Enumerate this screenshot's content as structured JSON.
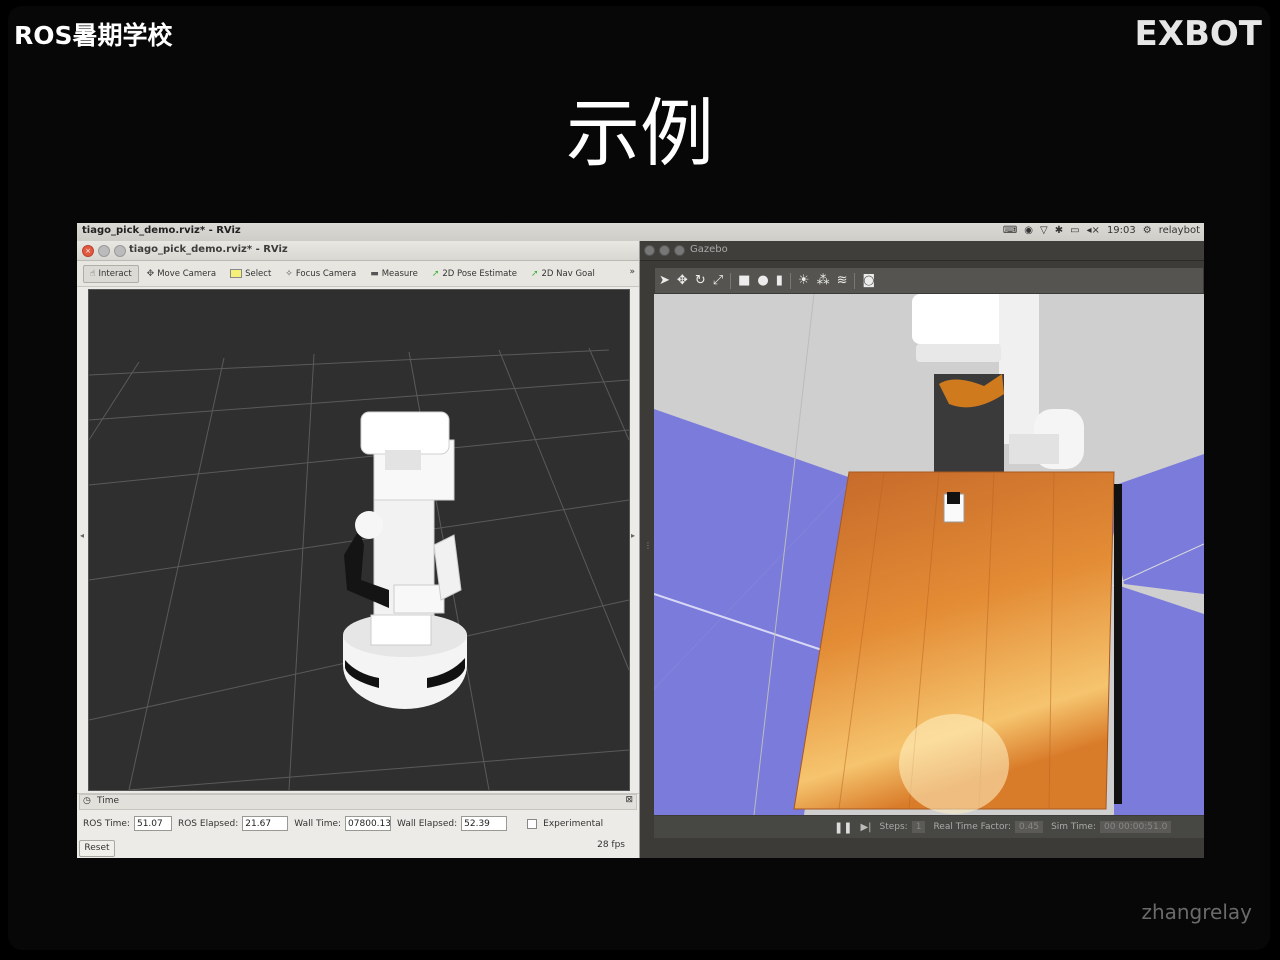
{
  "slide": {
    "brand_left": "ROS暑期学校",
    "brand_right": "EXBOT",
    "title": "示例",
    "watermark": "zhangrelay"
  },
  "desktop": {
    "active_app_title": "tiago_pick_demo.rviz* - RViz",
    "clock": "19:03",
    "user": "relaybot"
  },
  "rviz": {
    "window_title": "tiago_pick_demo.rviz* - RViz",
    "tools": [
      {
        "label": "Interact",
        "icon": "hand-icon"
      },
      {
        "label": "Move Camera",
        "icon": "move-camera-icon"
      },
      {
        "label": "Select",
        "icon": "select-icon"
      },
      {
        "label": "Focus Camera",
        "icon": "focus-camera-icon"
      },
      {
        "label": "Measure",
        "icon": "measure-icon"
      },
      {
        "label": "2D Pose Estimate",
        "icon": "pose-arrow-icon"
      },
      {
        "label": "2D Nav Goal",
        "icon": "nav-arrow-icon"
      }
    ],
    "more": "»",
    "time_panel": {
      "header": "Time",
      "ros_time_label": "ROS Time:",
      "ros_time": "51.07",
      "ros_elapsed_label": "ROS Elapsed:",
      "ros_elapsed": "21.67",
      "wall_time_label": "Wall Time:",
      "wall_time": "07800.13",
      "wall_elapsed_label": "Wall Elapsed:",
      "wall_elapsed": "52.39",
      "experimental_label": "Experimental",
      "reset_label": "Reset",
      "fps": "28 fps"
    }
  },
  "gazebo": {
    "window_title": "Gazebo",
    "bottom": {
      "steps_label": "Steps:",
      "steps_value": "1",
      "rtf_label": "Real Time Factor:",
      "rtf_value": "0.45",
      "sim_time_label": "Sim Time:",
      "sim_time_value": "00 00:00:51.0"
    }
  },
  "colors": {
    "slide_bg": "#070707",
    "rviz_viewport": "#2f2f2f",
    "gazebo_floor": "#7b7bdc",
    "table_wood": "#e08a2e"
  }
}
